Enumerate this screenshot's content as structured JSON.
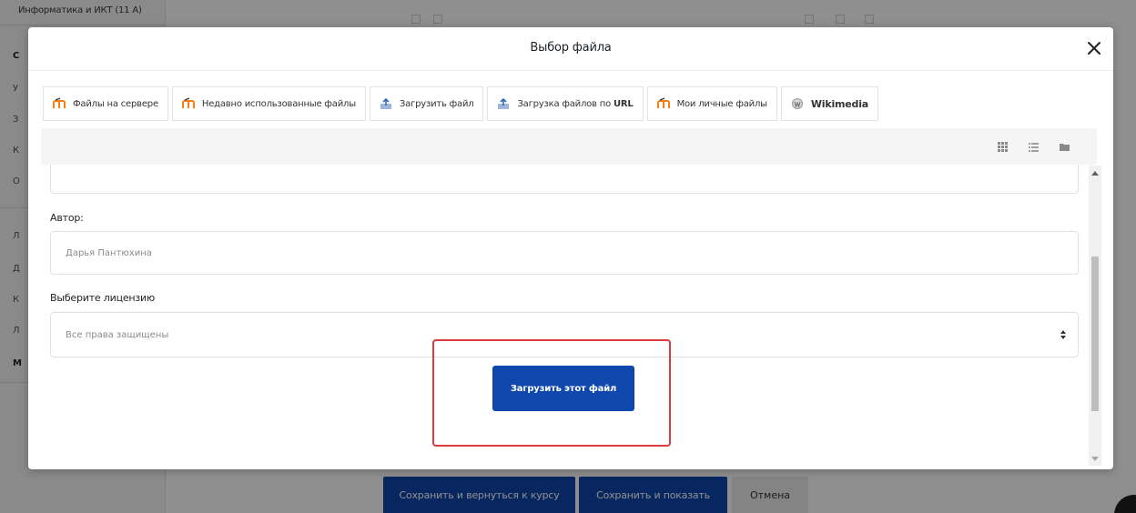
{
  "background": {
    "course_link": "Информатика и ИКТ (11 А)",
    "sidebar_letters": [
      "С",
      "У",
      "З",
      "К",
      "О",
      "Л",
      "Д",
      "К",
      "Л",
      "М"
    ],
    "buttons": {
      "save_return": "Сохранить и вернуться к курсу",
      "save_show": "Сохранить и показать",
      "cancel": "Отмена"
    }
  },
  "modal": {
    "title": "Выбор файла",
    "close_icon": "close-icon",
    "tabs": [
      {
        "label": "Файлы на сервере",
        "icon": "moodle-icon"
      },
      {
        "label": "Недавно использованные файлы",
        "icon": "moodle-icon"
      },
      {
        "label": "Загрузить файл",
        "icon": "upload-icon"
      },
      {
        "label": "Загрузка файлов по",
        "label_strong": "URL",
        "icon": "upload-icon"
      },
      {
        "label": "Мои личные файлы",
        "icon": "moodle-icon"
      },
      {
        "label": "",
        "label_strong": "Wikimedia",
        "icon": "wikimedia-icon"
      }
    ],
    "view_modes": [
      "grid-view-icon",
      "list-view-icon",
      "folder-view-icon"
    ],
    "form": {
      "author_label": "Автор:",
      "author_value": "Дарья Пантюхина",
      "license_label": "Выберите лицензию",
      "license_value": "Все права защищены",
      "upload_button": "Загрузить этот файл"
    }
  },
  "colors": {
    "accent": "#0f47ad",
    "highlight": "#e03a3a",
    "moodle_orange": "#f98012"
  }
}
